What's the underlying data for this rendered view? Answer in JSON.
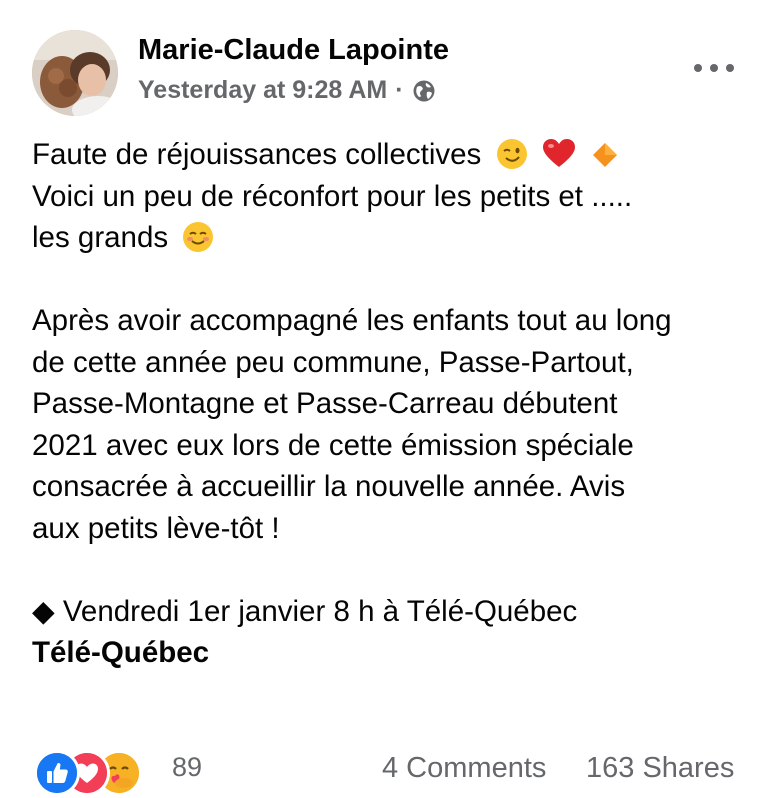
{
  "post": {
    "author": "Marie-Claude Lapointe",
    "timestamp": "Yesterday at 9:28 AM",
    "separator": "·",
    "privacy_icon": "globe-icon",
    "more_icon": "more-options-icon",
    "lines": {
      "l1": "Faute de réjouissances collectives",
      "l2": "Voici un peu de réconfort pour les petits et .....",
      "l3": "les grands",
      "p2_1": "Après avoir accompagné les enfants tout au long",
      "p2_2": "de cette année peu commune, Passe-Partout,",
      "p2_3": "Passe-Montagne et Passe-Carreau débutent",
      "p2_4": "2021 avec eux lors de cette émission spéciale",
      "p2_5": "consacrée à accueillir la nouvelle année. Avis",
      "p2_6": "aux petits lève-tôt !",
      "schedule": "◆ Vendredi 1er janvier 8 h à Télé-Québec"
    },
    "page_mention": "Télé-Québec",
    "emojis": [
      "winking-face-emoji",
      "red-heart-emoji",
      "orange-diamond-emoji",
      "smiling-face-emoji"
    ]
  },
  "footer": {
    "reactions": [
      "like-reaction-icon",
      "love-reaction-icon",
      "care-reaction-icon"
    ],
    "reaction_count": "89",
    "comments": "4 Comments",
    "shares": "163 Shares"
  },
  "colors": {
    "text": "#050505",
    "secondary": "#65676b",
    "like": "#1877f2",
    "love": "#f33e58",
    "care": "#f7b125"
  }
}
